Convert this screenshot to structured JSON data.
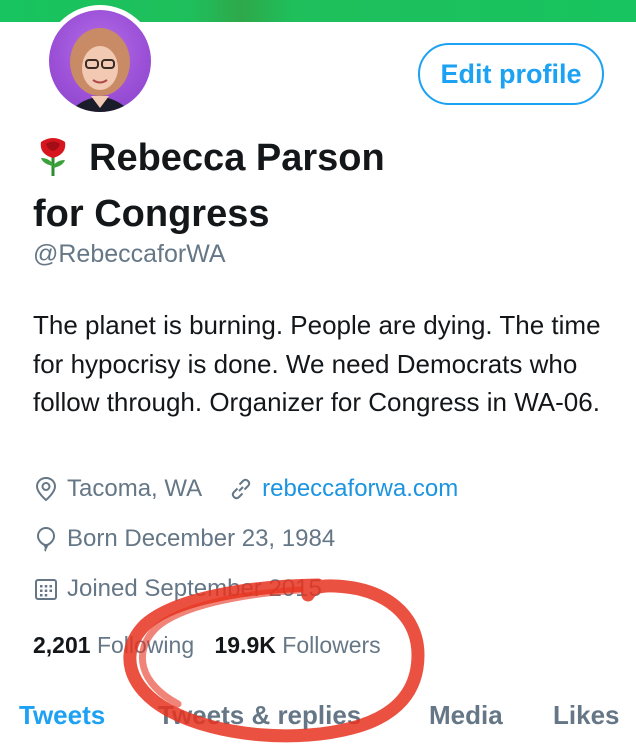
{
  "profile": {
    "name_line1": "Rebecca Parson",
    "name_line2": "for Congress",
    "handle": "@RebeccaforWA",
    "bio": "The planet is burning. People are dying. The time for hypocrisy is done. We need Democrats who follow through. Organizer for Congress in WA-06.",
    "location": "Tacoma, WA",
    "website": "rebeccaforwa.com",
    "born": "Born December 23, 1984",
    "joined": "Joined September 2015",
    "following_count": "2,201",
    "following_label": "Following",
    "followers_count": "19.9K",
    "followers_label": "Followers"
  },
  "buttons": {
    "edit_profile": "Edit profile"
  },
  "tabs": [
    "Tweets",
    "Tweets & replies",
    "Media",
    "Likes"
  ],
  "icons": {
    "name_emoji": "rose-icon",
    "location": "location-pin-icon",
    "website": "link-icon",
    "born": "balloon-icon",
    "joined": "calendar-icon"
  },
  "colors": {
    "accent": "#1da1f2",
    "link": "#1b95e0",
    "muted": "#657786",
    "banner": "#17c45f",
    "avatar_bg": "#9a4fd6",
    "annotation": "#e8321e"
  }
}
